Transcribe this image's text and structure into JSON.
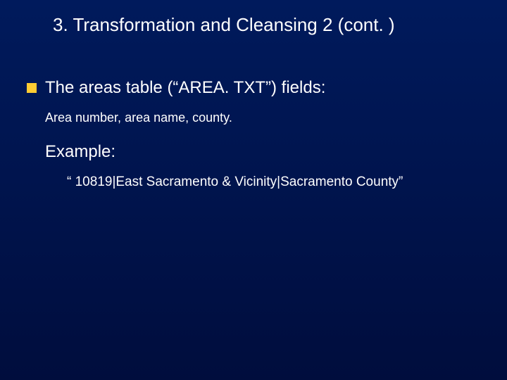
{
  "title": "3. Transformation and Cleansing 2 (cont. )",
  "bullet_text": "The areas table (“AREA. TXT”) fields:",
  "sub1": "Area number, area name, county.",
  "example_label": "Example:",
  "example_line": "“ 10819|East Sacramento & Vicinity|Sacramento County”"
}
